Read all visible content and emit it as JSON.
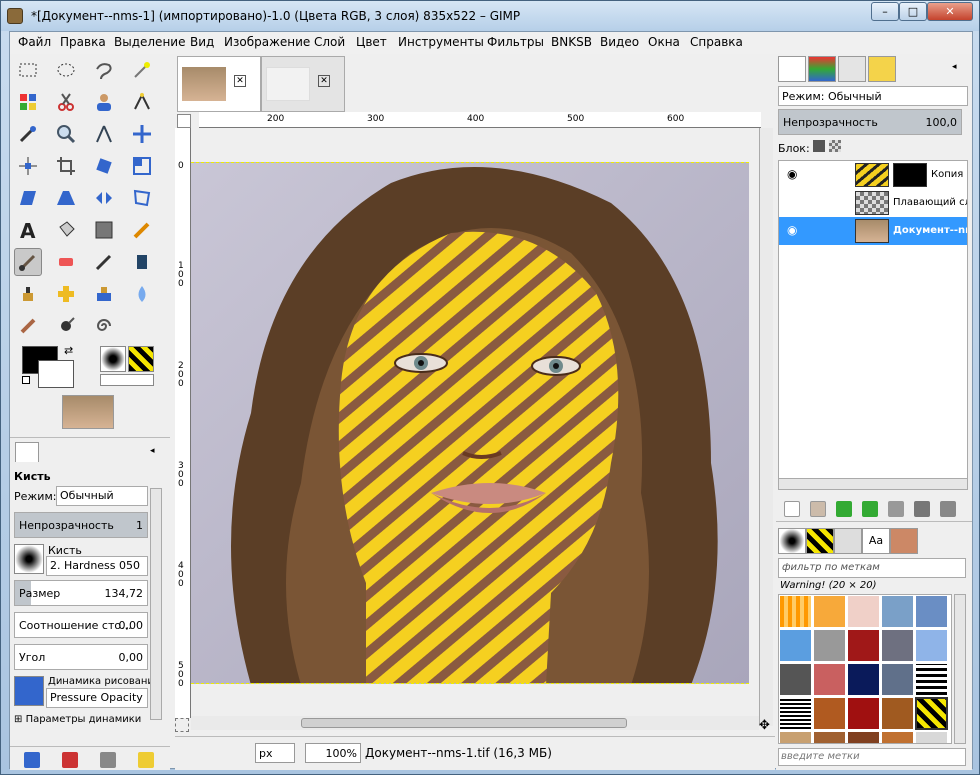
{
  "window": {
    "title": "*[Документ--nms-1] (импортировано)-1.0 (Цвета RGB, 3 слоя) 835x522 – GIMP",
    "min": "–",
    "max": "□",
    "close": "✕"
  },
  "menu": [
    "Файл",
    "Правка",
    "Выделение",
    "Вид",
    "Изображение",
    "Слой",
    "Цвет",
    "Инструменты",
    "Фильтры",
    "BNKSB",
    "Видео",
    "Окна",
    "Справка"
  ],
  "tool_options": {
    "title": "Кисть",
    "mode_label": "Режим:",
    "mode_value": "Обычный",
    "opacity_label": "Непрозрачность",
    "opacity_value": "1",
    "opacity_level": 1.0,
    "brush_label": "Кисть",
    "brush_value": "2. Hardness 050",
    "size_label": "Размер",
    "size_value": "134,72",
    "size_level": 0.12,
    "ratio_label": "Соотношение сто...",
    "ratio_value": "0,00",
    "angle_label": "Угол",
    "angle_value": "0,00",
    "dynamics_label": "Динамика рисовани",
    "dynamics_value": "Pressure Opacity",
    "dynamics_params": "Параметры динамики"
  },
  "canvas": {
    "ruler_h": [
      "200",
      "300",
      "400",
      "500",
      "600"
    ],
    "ruler_v": [
      "0",
      "1\n0\n0",
      "2\n0\n0",
      "3\n0\n0",
      "4\n0\n0",
      "5\n0\n0"
    ],
    "unit": "px",
    "zoom": "100%",
    "status": "Документ--nms-1.tif (16,3 МБ)"
  },
  "layers": {
    "mode_label": "Режим:",
    "mode_value": "Обычный",
    "opacity_label": "Непрозрачность",
    "opacity_value": "100,0",
    "lock_label": "Блок:",
    "items": [
      {
        "name": "Копия Пл",
        "visible": true
      },
      {
        "name": "Плавающий сло",
        "visible": false
      },
      {
        "name": "Документ--nms",
        "visible": true
      }
    ]
  },
  "patterns": {
    "filter_placeholder": "фильтр по меткам",
    "warning": "Warning! (20 × 20)",
    "tag_placeholder": "введите метки",
    "tab_text": "Aa"
  },
  "colors": {
    "accent": "#3399ff",
    "fg": "#000000",
    "bg": "#ffffff",
    "stripe_yellow": "#f5d020",
    "stripe_brown": "#8a5a40"
  }
}
